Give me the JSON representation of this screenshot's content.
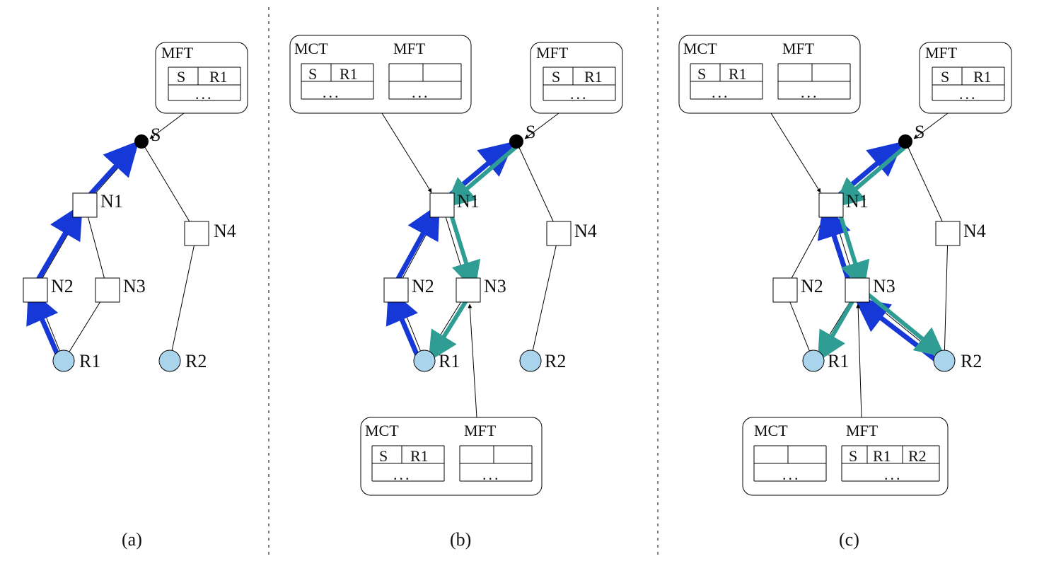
{
  "diagram": {
    "nodes": {
      "S": {
        "label": "S"
      },
      "N1": {
        "label": "N1"
      },
      "N2": {
        "label": "N2"
      },
      "N3": {
        "label": "N3"
      },
      "N4": {
        "label": "N4"
      },
      "R1": {
        "label": "R1"
      },
      "R2": {
        "label": "R2"
      }
    },
    "colors": {
      "blue": "#1638d6",
      "teal": "#2f9d93",
      "receiver_fill": "#aad4ec",
      "text": "#111111"
    },
    "panels": [
      {
        "id": "a",
        "label": "(a)",
        "blue_path": [
          "R1",
          "N2",
          "N1",
          "S"
        ],
        "teal_path": [],
        "callouts": [
          {
            "at": "S",
            "tables": [
              {
                "title": "MFT",
                "rows": [
                  [
                    "S",
                    "R1"
                  ]
                ]
              }
            ]
          }
        ]
      },
      {
        "id": "b",
        "label": "(b)",
        "blue_path": [
          "R1",
          "N2",
          "N1",
          "S"
        ],
        "teal_path": [
          "R1",
          "N3",
          "N1",
          "S"
        ],
        "callouts": [
          {
            "at": "S",
            "tables": [
              {
                "title": "MFT",
                "rows": [
                  [
                    "S",
                    "R1"
                  ]
                ]
              }
            ]
          },
          {
            "at": "N1",
            "tables": [
              {
                "title": "MCT",
                "rows": [
                  [
                    "S",
                    "R1"
                  ]
                ]
              },
              {
                "title": "MFT",
                "rows": []
              }
            ]
          },
          {
            "at": "N3",
            "tables": [
              {
                "title": "MCT",
                "rows": [
                  [
                    "S",
                    "R1"
                  ]
                ]
              },
              {
                "title": "MFT",
                "rows": []
              }
            ]
          }
        ]
      },
      {
        "id": "c",
        "label": "(c)",
        "blue_path": [
          "R2",
          "N3",
          "N1",
          "S"
        ],
        "teal_path_forward": [
          [
            "S",
            "N1"
          ],
          [
            "N1",
            "N3"
          ],
          [
            "N3",
            "R1"
          ],
          [
            "N3",
            "R2"
          ]
        ],
        "callouts": [
          {
            "at": "S",
            "tables": [
              {
                "title": "MFT",
                "rows": [
                  [
                    "S",
                    "R1"
                  ]
                ]
              }
            ]
          },
          {
            "at": "N1",
            "tables": [
              {
                "title": "MCT",
                "rows": [
                  [
                    "S",
                    "R1"
                  ]
                ]
              },
              {
                "title": "MFT",
                "rows": []
              }
            ]
          },
          {
            "at": "N3",
            "tables": [
              {
                "title": "MCT",
                "rows": []
              },
              {
                "title": "MFT",
                "rows": [
                  [
                    "S",
                    "R1",
                    "R2"
                  ]
                ]
              }
            ]
          }
        ]
      }
    ],
    "ellipsis": "..."
  }
}
